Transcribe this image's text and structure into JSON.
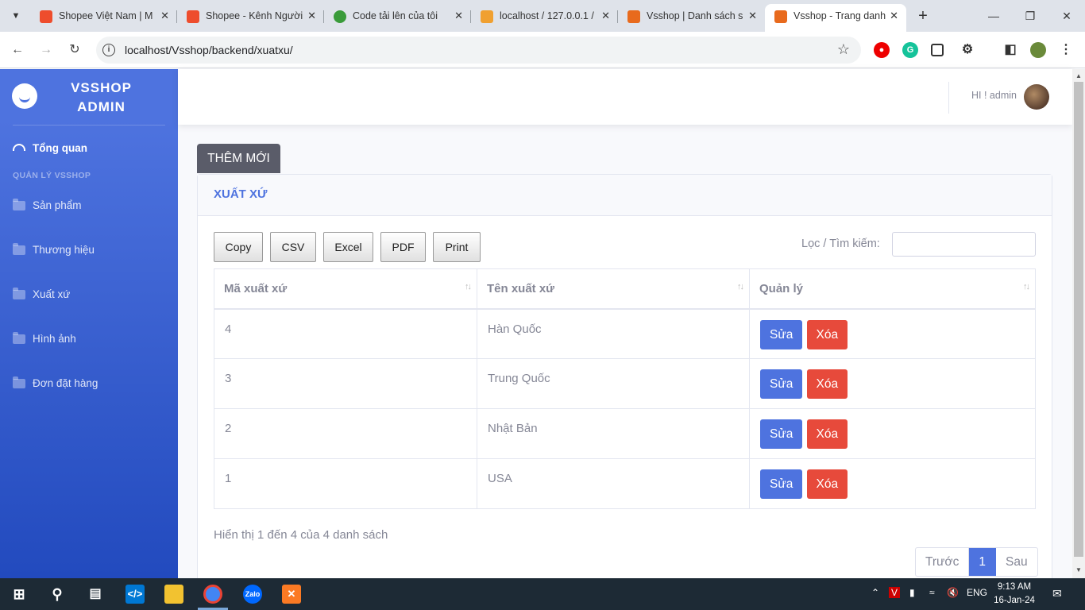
{
  "browser": {
    "tabs": [
      {
        "title": "Shopee Việt Nam | M",
        "color": "#ee4d2d"
      },
      {
        "title": "Shopee - Kênh Người",
        "color": "#ee4d2d"
      },
      {
        "title": "Code tải lên của tôi",
        "color": "#3a9b3a"
      },
      {
        "title": "localhost / 127.0.0.1 /",
        "color": "#f0a030"
      },
      {
        "title": "Vsshop | Danh sách s",
        "color": "#e86a1d"
      },
      {
        "title": "Vsshop - Trang danh",
        "color": "#e86a1d",
        "active": true
      }
    ],
    "url": "localhost/Vsshop/backend/xuatxu/"
  },
  "sidebar": {
    "brand": "VSSHOP ADMIN",
    "overview": "Tổng quan",
    "heading": "QUẢN LÝ VSSHOP",
    "items": [
      {
        "label": "Sản phẩm"
      },
      {
        "label": "Thương hiệu"
      },
      {
        "label": "Xuất xứ"
      },
      {
        "label": "Hình ảnh"
      },
      {
        "label": "Đơn đặt hàng"
      }
    ]
  },
  "topbar": {
    "greeting": "HI ! admin"
  },
  "main": {
    "add_button": "THÊM MỚI",
    "card_title": "XUẤT XỨ",
    "export_buttons": [
      "Copy",
      "CSV",
      "Excel",
      "PDF",
      "Print"
    ],
    "filter_label": "Lọc / Tìm kiếm:",
    "columns": [
      "Mã xuất xứ",
      "Tên xuất xứ",
      "Quản lý"
    ],
    "rows": [
      {
        "id": "4",
        "name": "Hàn Quốc"
      },
      {
        "id": "3",
        "name": "Trung Quốc"
      },
      {
        "id": "2",
        "name": "Nhật Bản"
      },
      {
        "id": "1",
        "name": "USA"
      }
    ],
    "edit_label": "Sửa",
    "delete_label": "Xóa",
    "info": "Hiển thị 1 đến 4 của 4 danh sách",
    "pager": {
      "prev": "Trước",
      "current": "1",
      "next": "Sau"
    }
  },
  "taskbar": {
    "lang": "ENG",
    "time": "9:13 AM",
    "date": "16-Jan-24"
  }
}
